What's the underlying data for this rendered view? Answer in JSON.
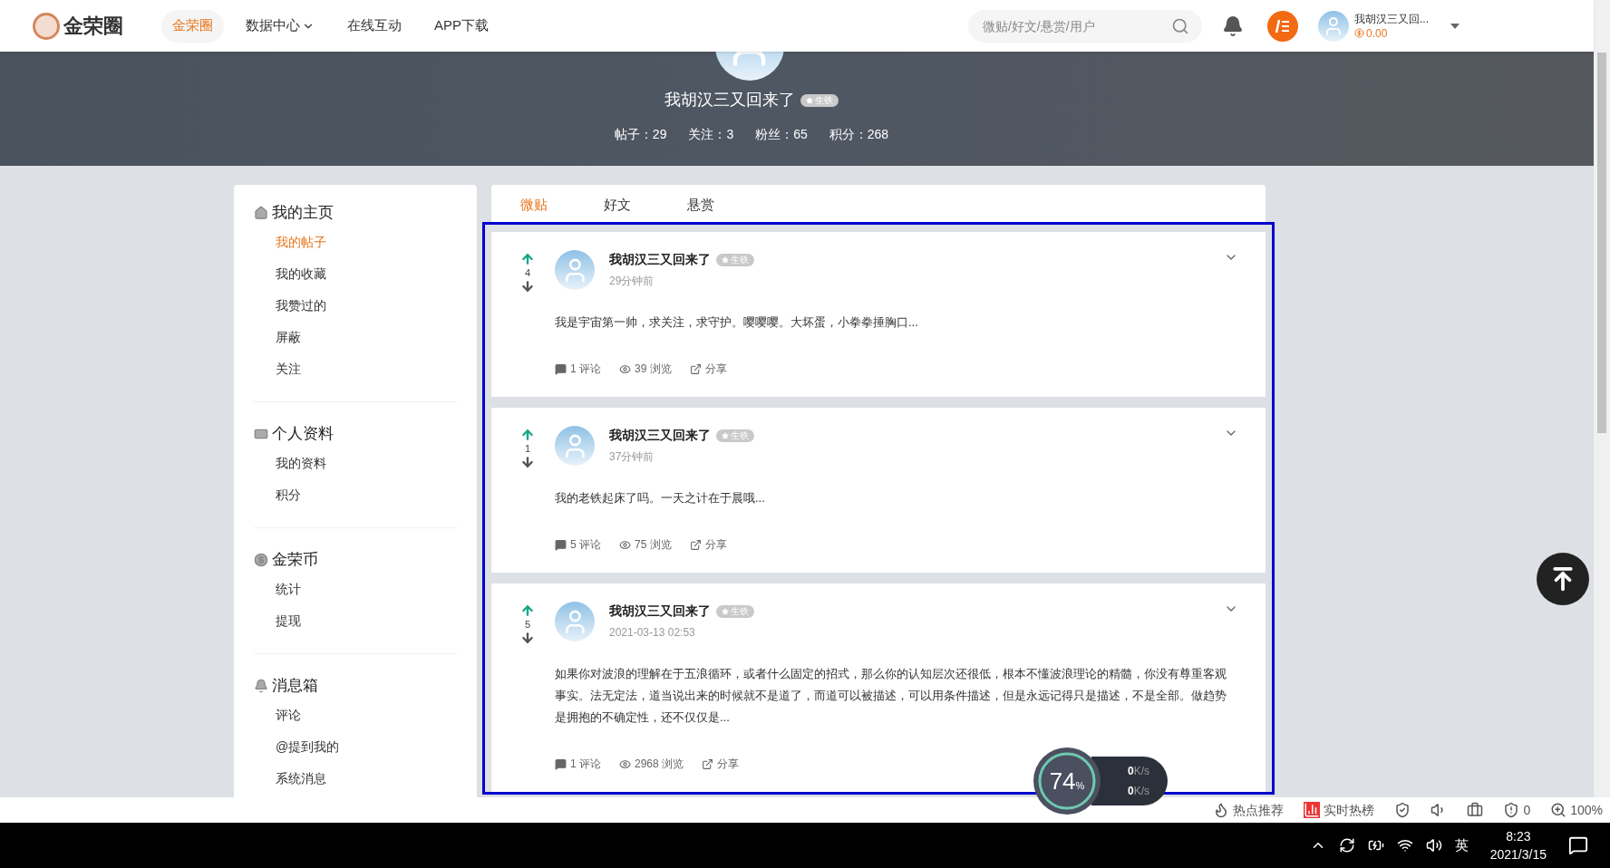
{
  "nav": {
    "logo": "金荣圈",
    "items": [
      {
        "label": "金荣圈",
        "selected": true,
        "kind": "link"
      },
      {
        "label": "数据中心",
        "selected": false,
        "kind": "dropdown"
      },
      {
        "label": "在线互动",
        "selected": false,
        "kind": "link"
      },
      {
        "label": "APP下载",
        "selected": false,
        "kind": "link"
      }
    ],
    "search": {
      "placeholder": "微贴/好文/悬赏/用户"
    },
    "user": {
      "name": "我胡汉三又回...",
      "balance": "0.00"
    }
  },
  "profile": {
    "name": "我胡汉三又回来了",
    "badge": "生铁",
    "stats": [
      "帖子：29",
      "关注：3",
      "粉丝：65",
      "积分：268"
    ]
  },
  "sidebar": [
    {
      "kind": "home",
      "title": "我的主页",
      "items": [
        {
          "label": "我的帖子",
          "selected": true
        },
        {
          "label": "我的收藏",
          "selected": false
        },
        {
          "label": "我赞过的",
          "selected": false
        },
        {
          "label": "屏蔽",
          "selected": false
        },
        {
          "label": "关注",
          "selected": false
        }
      ]
    },
    {
      "kind": "profile",
      "title": "个人资料",
      "items": [
        {
          "label": "我的资料",
          "selected": false
        },
        {
          "label": "积分",
          "selected": false
        }
      ]
    },
    {
      "kind": "coin",
      "title": "金荣币",
      "items": [
        {
          "label": "统计",
          "selected": false
        },
        {
          "label": "提现",
          "selected": false
        }
      ]
    },
    {
      "kind": "bell",
      "title": "消息箱",
      "items": [
        {
          "label": "评论",
          "selected": false
        },
        {
          "label": "@提到我的",
          "selected": false
        },
        {
          "label": "系统消息",
          "selected": false
        }
      ]
    }
  ],
  "tabs": [
    {
      "label": "微贴",
      "selected": true
    },
    {
      "label": "好文",
      "selected": false
    },
    {
      "label": "悬赏",
      "selected": false
    }
  ],
  "posts": [
    {
      "votes": "4",
      "author": "我胡汉三又回来了",
      "badge": "生铁",
      "time": "29分钟前",
      "text": "我是宇宙第一帅，求关注，求守护。嘤嘤嘤。大坏蛋，小拳拳捶胸口...",
      "comments": "1 评论",
      "views": "39 浏览",
      "share": "分享"
    },
    {
      "votes": "1",
      "author": "我胡汉三又回来了",
      "badge": "生铁",
      "time": "37分钟前",
      "text": "我的老铁起床了吗。一天之计在于晨哦...",
      "comments": "5 评论",
      "views": "75 浏览",
      "share": "分享"
    },
    {
      "votes": "5",
      "author": "我胡汉三又回来了",
      "badge": "生铁",
      "time": "2021-03-13 02:53",
      "text": "如果你对波浪的理解在于五浪循环，或者什么固定的招式，那么你的认知层次还很低，根本不懂波浪理论的精髓，你没有尊重客观事实。法无定法，道当说出来的时候就不是道了，而道可以被描述，可以用条件描述，但是永远记得只是描述，不是全部。做趋势是拥抱的不确定性，还不仅仅是...",
      "comments": "1 评论",
      "views": "2968 浏览",
      "share": "分享"
    }
  ],
  "speed_widget": {
    "percent": "74",
    "percent_unit": "%",
    "up": "0",
    "up_unit": "K/s",
    "down": "0",
    "down_unit": "K/s"
  },
  "browser_status": {
    "hot": "热点推荐",
    "trending": "实时热榜",
    "blocked": "0",
    "zoom": "100%"
  },
  "taskbar": {
    "ime": "英",
    "time": "8:23",
    "date": "2021/3/15"
  }
}
